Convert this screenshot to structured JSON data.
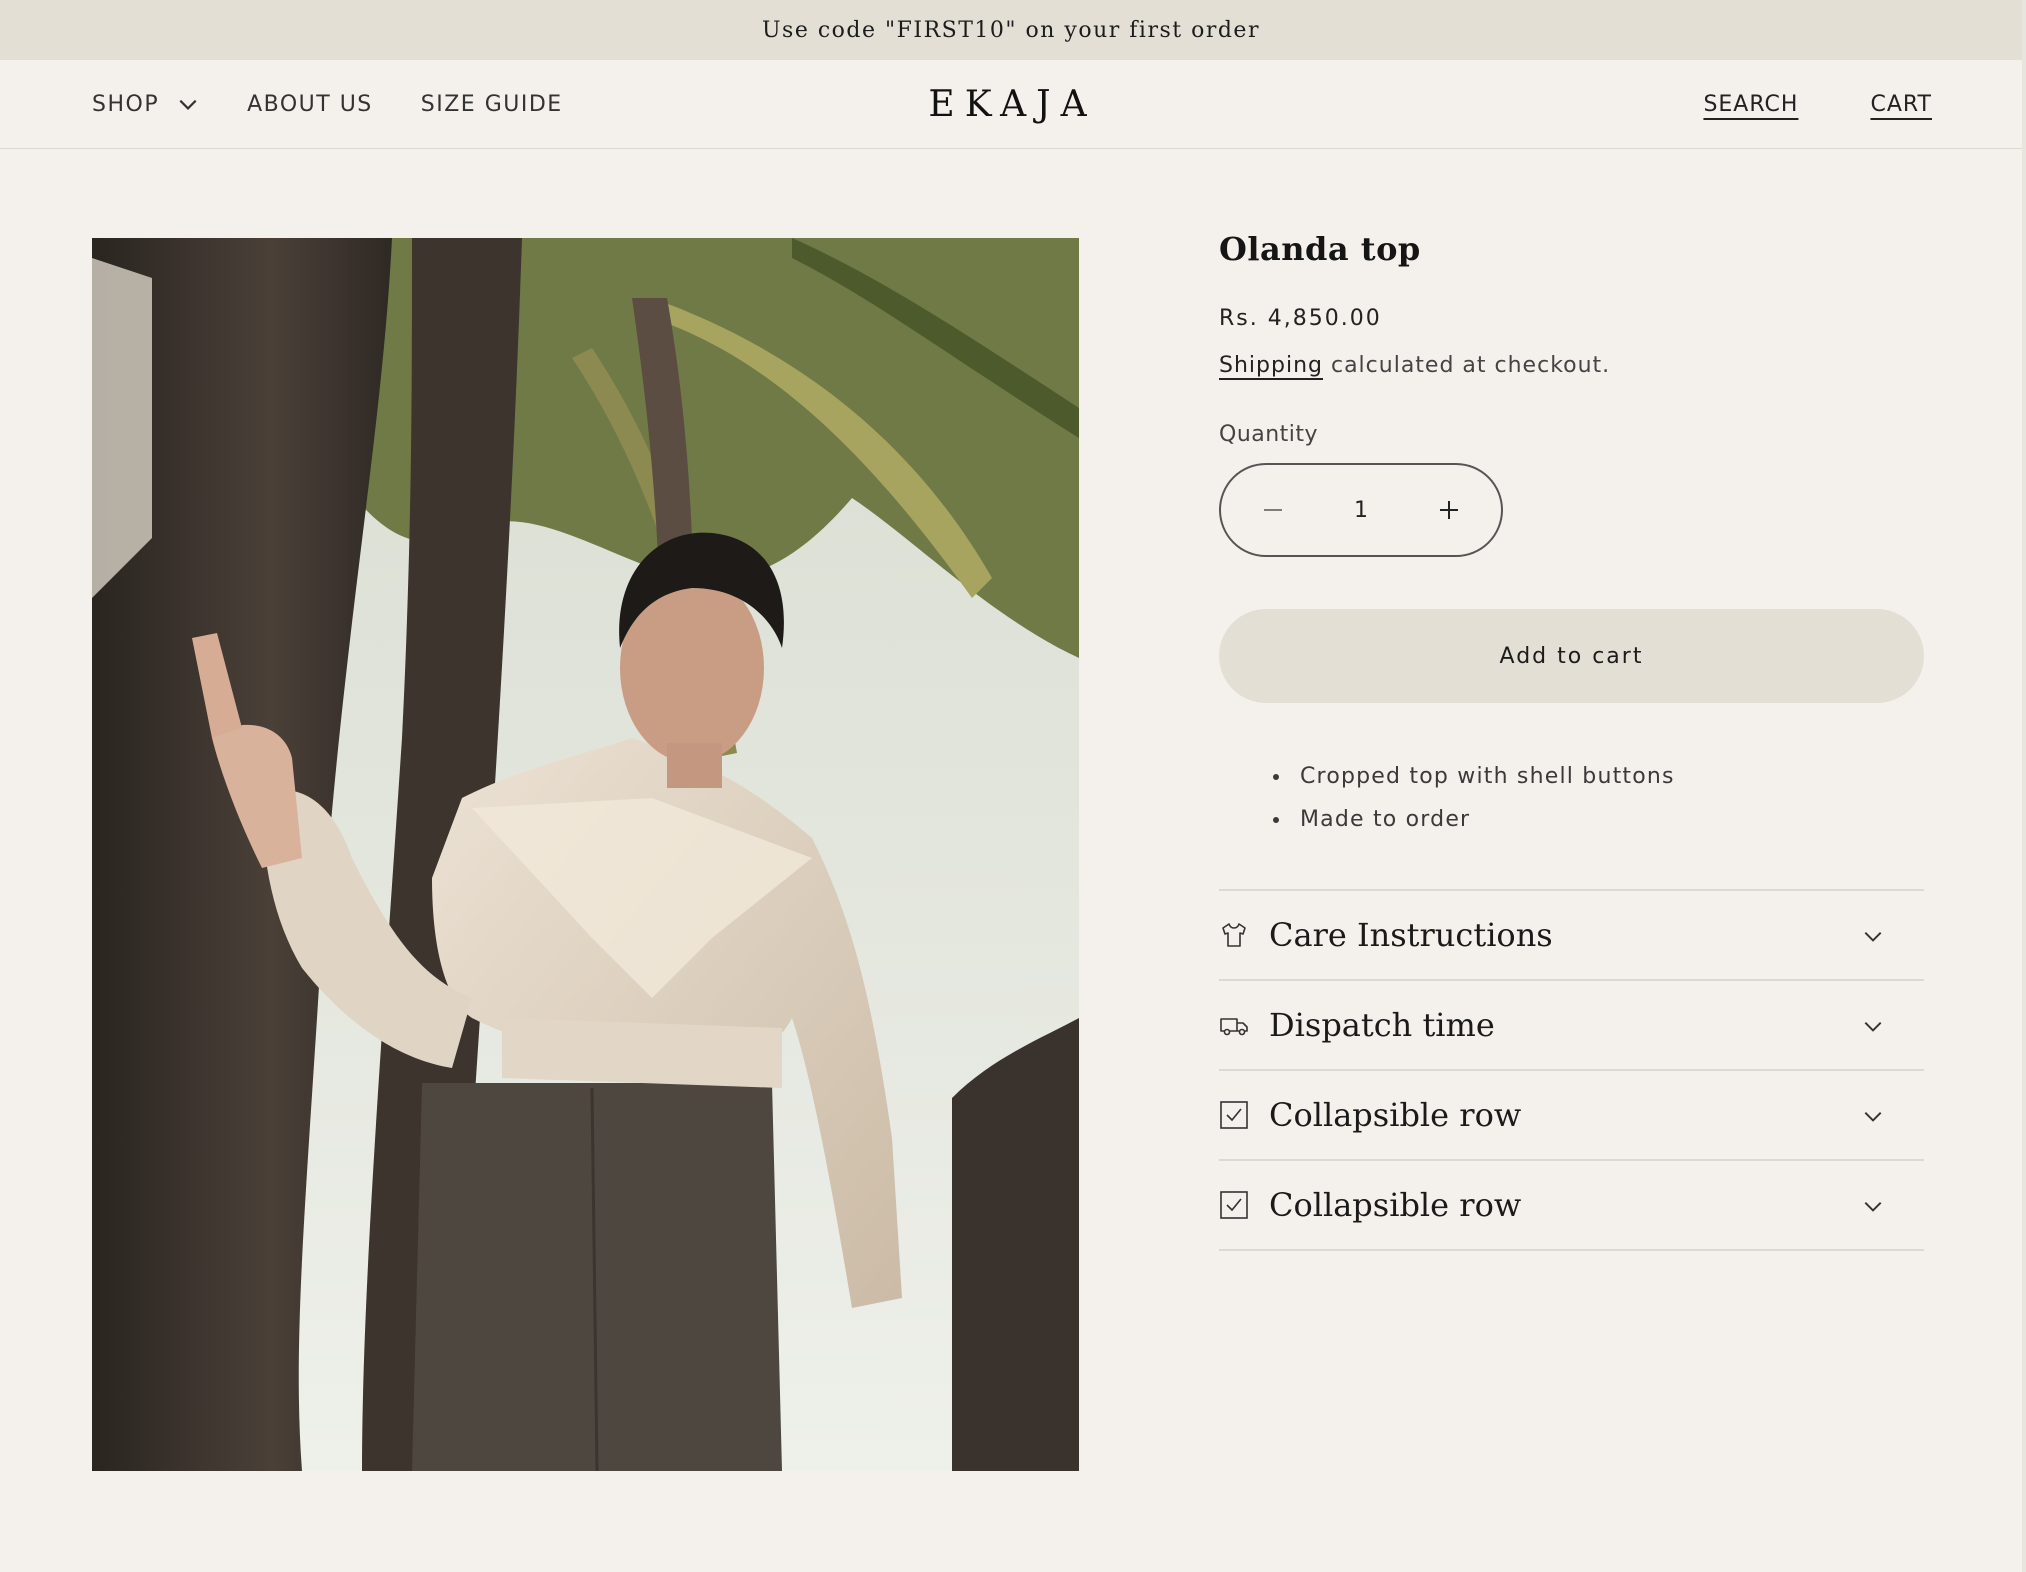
{
  "announcement": "Use code \"FIRST10\" on your first order",
  "header": {
    "nav": [
      {
        "label": "SHOP"
      },
      {
        "label": "ABOUT US"
      },
      {
        "label": "SIZE GUIDE"
      }
    ],
    "logo": "EKAJA",
    "search_label": "SEARCH",
    "cart_label": "CART"
  },
  "product": {
    "title": "Olanda top",
    "price": "Rs. 4,850.00",
    "shipping_link": "Shipping",
    "shipping_text": " calculated at checkout.",
    "quantity_label": "Quantity",
    "quantity_value": "1",
    "minus_icon": "minus-icon",
    "plus_icon": "plus-icon",
    "add_to_cart": "Add to cart",
    "bullets": [
      "Cropped top with shell buttons",
      "Made to order"
    ],
    "accordion": [
      {
        "label": "Care Instructions",
        "icon": "tshirt-icon"
      },
      {
        "label": "Dispatch time",
        "icon": "truck-icon"
      },
      {
        "label": "Collapsible row",
        "icon": "checkbox-icon"
      },
      {
        "label": "Collapsible row",
        "icon": "checkbox-icon"
      }
    ]
  },
  "colors": {
    "background": "#f4f0eb",
    "announcement_bg": "#e4dfd5",
    "button_bg": "#e4dfd5"
  }
}
